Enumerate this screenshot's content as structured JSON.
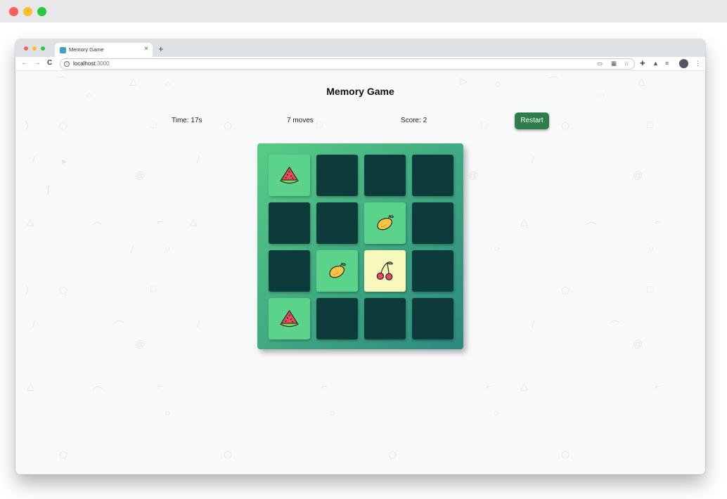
{
  "browser": {
    "tab_title": "Memory Game",
    "tab_close": "×",
    "new_tab": "+",
    "back": "←",
    "forward": "→",
    "reload": "C",
    "url_host": "localhost",
    "url_port": ":3000"
  },
  "game": {
    "title": "Memory Game",
    "time": "Time: 17s",
    "moves": "7 moves",
    "score": "Score: 2",
    "restart_label": "Restart"
  },
  "board": {
    "rows": 4,
    "cols": 4,
    "cards": [
      {
        "state": "matched",
        "fruit": "watermelon-icon"
      },
      {
        "state": "hidden",
        "fruit": ""
      },
      {
        "state": "hidden",
        "fruit": ""
      },
      {
        "state": "hidden",
        "fruit": ""
      },
      {
        "state": "hidden",
        "fruit": ""
      },
      {
        "state": "hidden",
        "fruit": ""
      },
      {
        "state": "matched",
        "fruit": "mango-icon"
      },
      {
        "state": "hidden",
        "fruit": ""
      },
      {
        "state": "hidden",
        "fruit": ""
      },
      {
        "state": "matched",
        "fruit": "mango-icon"
      },
      {
        "state": "flipped",
        "fruit": "cherry-icon"
      },
      {
        "state": "hidden",
        "fruit": ""
      },
      {
        "state": "matched",
        "fruit": "watermelon-icon"
      },
      {
        "state": "hidden",
        "fruit": ""
      },
      {
        "state": "hidden",
        "fruit": ""
      },
      {
        "state": "hidden",
        "fruit": ""
      }
    ]
  },
  "colors": {
    "hidden_card": "#0d3a3b",
    "matched_card": "#5bd38a",
    "flipped_card": "#f8f8bd",
    "restart_button": "#2f7d4a"
  }
}
